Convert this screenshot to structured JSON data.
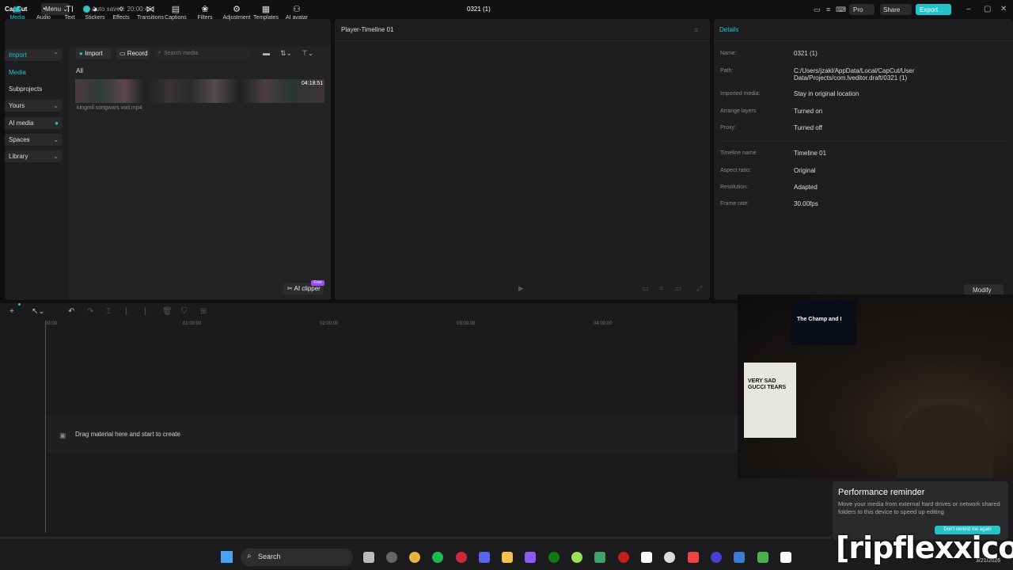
{
  "titlebar": {
    "logo": "CapCut",
    "menu": "Menu",
    "autosave": "Auto saved: 20:00:46",
    "title": "0321 (1)",
    "pro": "Pro",
    "share": "Share",
    "export": "Export"
  },
  "toolbar": [
    {
      "label": "Media",
      "icon": "▣"
    },
    {
      "label": "Audio",
      "icon": "◔"
    },
    {
      "label": "Text",
      "icon": "TI"
    },
    {
      "label": "Stickers",
      "icon": "◕"
    },
    {
      "label": "Effects",
      "icon": "✧"
    },
    {
      "label": "Transitions",
      "icon": "⋈"
    },
    {
      "label": "Captions",
      "icon": "▤"
    },
    {
      "label": "Filters",
      "icon": "❀"
    },
    {
      "label": "Adjustment",
      "icon": "⚙"
    },
    {
      "label": "Templates",
      "icon": "▦"
    },
    {
      "label": "AI avatar",
      "icon": "⚇"
    }
  ],
  "nav": {
    "import": "Import",
    "media": "Media",
    "subprojects": "Subprojects",
    "yours": "Yours",
    "ai_media": "AI media",
    "spaces": "Spaces",
    "library": "Library"
  },
  "media": {
    "import_btn": "Import",
    "record_btn": "Record",
    "search_placeholder": "Search media",
    "all": "All",
    "duration": "04:18:51",
    "file": "kingmil songwars vod.mp4",
    "ai_clipper": "AI clipper",
    "free": "Free"
  },
  "player": {
    "title": "Player-Timeline 01"
  },
  "details": {
    "heading": "Details",
    "rows": [
      {
        "label": "Name:",
        "value": "0321 (1)"
      },
      {
        "label": "Path:",
        "value": "C:/Users/jzakl/AppData/Local/CapCut/User Data/Projects/com.lveditor.draft/0321 (1)"
      },
      {
        "label": "Imported media:",
        "value": "Stay in original location"
      },
      {
        "label": "Arrange layers",
        "value": "Turned on"
      },
      {
        "label": "Proxy:",
        "value": "Turned off"
      },
      {
        "label": "Timeline name",
        "value": "Timeline 01"
      },
      {
        "label": "Aspect ratio:",
        "value": "Original"
      },
      {
        "label": "Resolution:",
        "value": "Adapted"
      },
      {
        "label": "Frame rate:",
        "value": "30.00fps"
      }
    ],
    "modify": "Modify"
  },
  "timeline": {
    "ruler": [
      "00:00",
      "01:00:00",
      "02:00:00",
      "03:00:00",
      "04:00:00"
    ],
    "drop_text": "Drag material here and start to create"
  },
  "webcam": {
    "song": "The Champ and I",
    "shirt": "VERY SAD GUCCI TEARS"
  },
  "toast": {
    "title": "Performance reminder",
    "body": "Move your media from external hard drives or network shared folders to this device to speed up editing",
    "button": "Don't remind me again"
  },
  "taskbar": {
    "search": "Search",
    "date": "3/21/2026",
    "watermark": "[ripflexxico]"
  },
  "colors": {
    "accent": "#22c4cc",
    "panel": "#1e1e20",
    "background": "#0f0f10"
  }
}
